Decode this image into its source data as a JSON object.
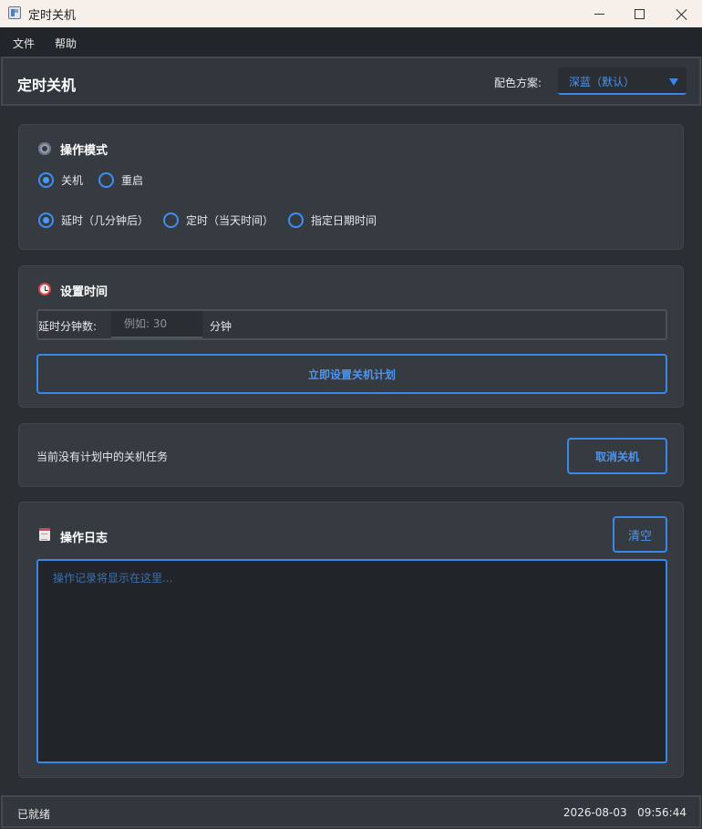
{
  "window": {
    "title": "定时关机"
  },
  "menu": {
    "items": [
      "文件",
      "帮助"
    ]
  },
  "header": {
    "title": "定时关机",
    "scheme_label": "配色方案:",
    "scheme_value": "深蓝（默认）"
  },
  "mode_card": {
    "title": "操作模式",
    "icon": "gear-icon",
    "action_options": [
      {
        "label": "关机",
        "selected": true
      },
      {
        "label": "重启",
        "selected": false
      }
    ],
    "timing_options": [
      {
        "label": "延时（几分钟后）",
        "selected": true
      },
      {
        "label": "定时（当天时间）",
        "selected": false
      },
      {
        "label": "指定日期时间",
        "selected": false
      }
    ]
  },
  "time_card": {
    "title": "设置时间",
    "icon": "alarm-clock-icon",
    "delay_label": "延时分钟数:",
    "delay_placeholder": "例如: 30",
    "delay_value": "",
    "unit": "分钟",
    "submit_label": "立即设置关机计划"
  },
  "status_card": {
    "message": "当前没有计划中的关机任务",
    "cancel_label": "取消关机"
  },
  "log_card": {
    "title": "操作日志",
    "icon": "notepad-icon",
    "clear_label": "清空",
    "placeholder": "操作记录将显示在这里..."
  },
  "statusbar": {
    "status": "已就绪",
    "datetime": "2026-08-03   09:56:44"
  },
  "colors": {
    "accent": "#3a87e8",
    "background": "#2b2f34",
    "card": "#363b41"
  }
}
